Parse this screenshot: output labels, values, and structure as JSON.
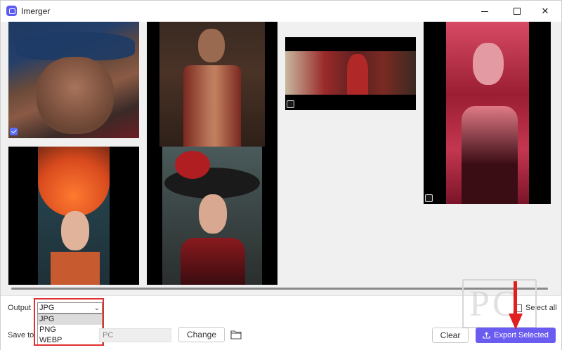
{
  "window": {
    "title": "Imerger"
  },
  "titlebar_controls": {
    "minimize": "minimize-icon",
    "maximize": "maximize-icon",
    "close": "close-icon"
  },
  "gallery": {
    "images": [
      {
        "id": "img1",
        "description_icon": "photo",
        "checked": true
      },
      {
        "id": "img2",
        "description_icon": "photo",
        "checked": false
      },
      {
        "id": "img3",
        "description_icon": "photo",
        "checked": false
      },
      {
        "id": "img4",
        "description_icon": "photo",
        "checked": false
      },
      {
        "id": "img5",
        "description_icon": "photo",
        "checked": false
      },
      {
        "id": "img6",
        "description_icon": "photo",
        "checked": false
      }
    ]
  },
  "controls": {
    "output_label": "Output",
    "output_selected": "JPG",
    "output_options": [
      "JPG",
      "PNG",
      "WEBP"
    ],
    "saveto_label": "Save to",
    "saveto_path": "PC",
    "change_label": "Change",
    "select_all_label": "Select all",
    "clear_label": "Clear",
    "export_label": "Export Selected"
  },
  "watermark": {
    "text": "PC"
  },
  "colors": {
    "accent": "#6a5cf0",
    "highlight": "#e03030",
    "arrow": "#e02020"
  }
}
